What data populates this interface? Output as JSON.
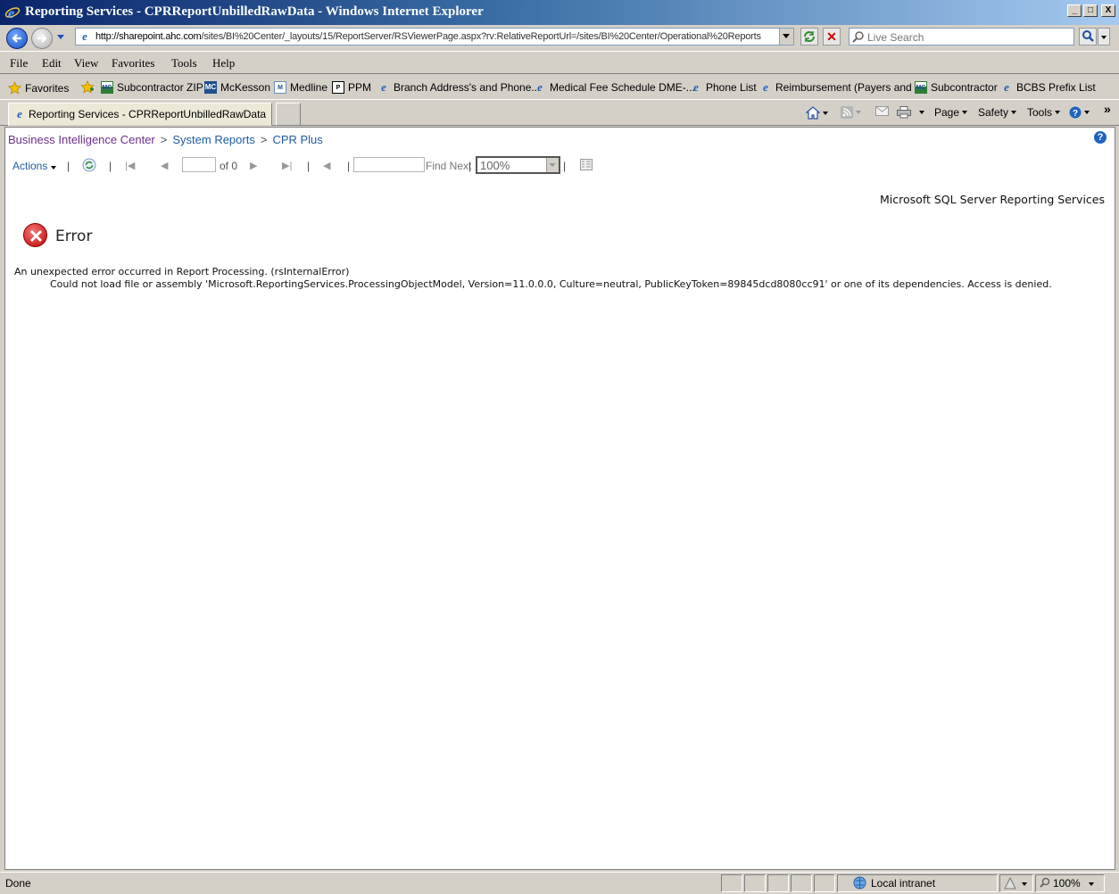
{
  "window": {
    "title": "Reporting Services - CPRReportUnbilledRawData - Windows Internet Explorer",
    "minimize": "_",
    "maximize": "□",
    "close": "X"
  },
  "address": {
    "url_host": "http://sharepoint.ahc.com",
    "url_path": "/sites/BI%20Center/_layouts/15/ReportServer/RSViewerPage.aspx?rv:RelativeReportUrl=/sites/BI%20Center/Operational%20Reports"
  },
  "search": {
    "placeholder": "Live Search"
  },
  "menu": [
    "File",
    "Edit",
    "View",
    "Favorites",
    "Tools",
    "Help"
  ],
  "favorites": {
    "label": "Favorites",
    "items": [
      {
        "label": "Subcontractor ZIP",
        "icon": "mcg"
      },
      {
        "label": "McKesson",
        "icon": "mc"
      },
      {
        "label": "Medline",
        "icon": "med"
      },
      {
        "label": "PPM",
        "icon": "ppm"
      },
      {
        "label": "Branch Address's and Phone...",
        "icon": "ie"
      },
      {
        "label": "Medical Fee Schedule DME-...",
        "icon": "ie"
      },
      {
        "label": "Phone List",
        "icon": "ie"
      },
      {
        "label": "Reimbursement (Payers and ...",
        "icon": "ie"
      },
      {
        "label": "Subcontractor",
        "icon": "mcg"
      },
      {
        "label": "BCBS Prefix List",
        "icon": "ie"
      }
    ]
  },
  "tab": {
    "label": "Reporting Services - CPRReportUnbilledRawData"
  },
  "commands": {
    "page": "Page",
    "safety": "Safety",
    "tools": "Tools"
  },
  "breadcrumb": {
    "items": [
      "Business Intelligence Center",
      "System Reports",
      "CPR Plus"
    ],
    "separator": ">"
  },
  "report_toolbar": {
    "actions": "Actions",
    "page_of": "of 0",
    "find_next": "Find Next",
    "zoom": "100%",
    "pipe": "|"
  },
  "report": {
    "brand": "Microsoft SQL Server Reporting Services",
    "error_title": "Error",
    "error_line1": "An unexpected error occurred in Report Processing. (rsInternalError)",
    "error_line2": "Could not load file or assembly 'Microsoft.ReportingServices.ProcessingObjectModel, Version=11.0.0.0, Culture=neutral, PublicKeyToken=89845dcd8080cc91' or one of its dependencies. Access is denied."
  },
  "status": {
    "text": "Done",
    "zone": "Local intranet",
    "zoom": "100%"
  },
  "colors": {
    "link": "#1f5c9e",
    "visited": "#6b2f8a",
    "error_red": "#c00000"
  }
}
